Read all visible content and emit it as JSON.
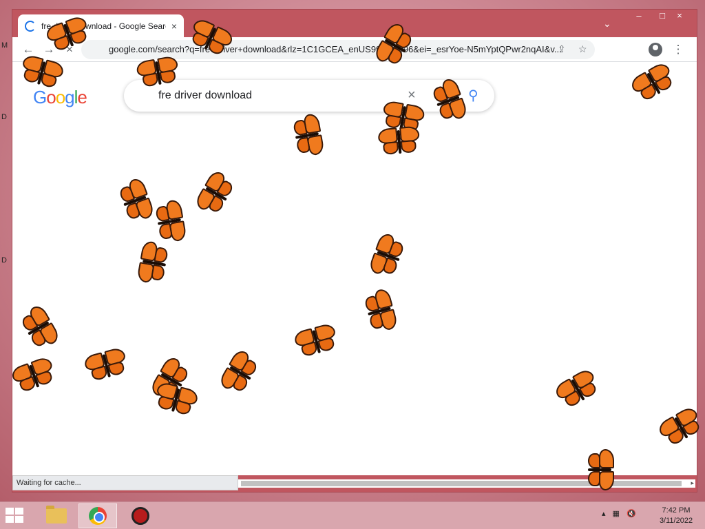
{
  "desktop": {
    "letters": [
      "M",
      "D",
      "D"
    ]
  },
  "browser": {
    "tab": {
      "title": "fre driver download - Google Search",
      "close_icon": "×"
    },
    "new_tab_icon": "+",
    "tab_search_icon": "⌄",
    "window_controls": {
      "minimize": "–",
      "maximize": "□",
      "close": "×"
    },
    "toolbar": {
      "back_icon": "←",
      "forward_icon": "→",
      "stop_icon": "×",
      "url": "google.com/search?q=fre+driver+download&rlz=1C1GCEA_enUS996US996&ei=_esrYoe-N5mYptQPwr2nqAI&v...",
      "share_icon": "⇪",
      "bookmark_icon": "☆",
      "menu_icon": "⋮"
    },
    "google": {
      "logo_letters": [
        "G",
        "o",
        "o",
        "g",
        "l",
        "e"
      ],
      "query": "fre driver download",
      "clear_icon": "×",
      "search_icon": "⚲"
    },
    "status": "Waiting for cache...",
    "scroll_arrow": "▸"
  },
  "taskbar": {
    "tray_arrow": "▴",
    "network_icon": "▦",
    "volume_icon": "🔇",
    "time": "7:42 PM",
    "date": "3/11/2022"
  },
  "colors": {
    "window_frame": "#c0565f",
    "butterfly": "#f07a1e"
  }
}
